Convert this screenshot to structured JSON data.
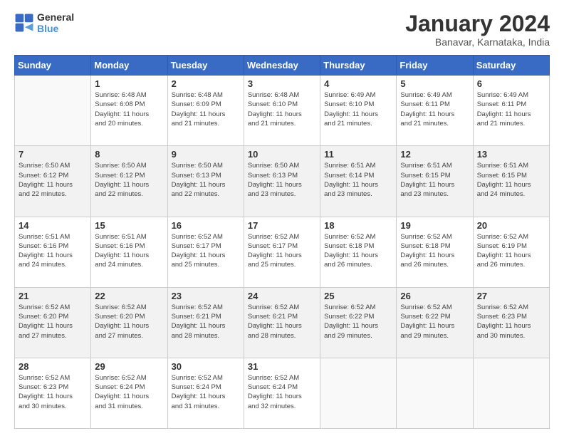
{
  "logo": {
    "line1": "General",
    "line2": "Blue"
  },
  "title": "January 2024",
  "subtitle": "Banavar, Karnataka, India",
  "days_of_week": [
    "Sunday",
    "Monday",
    "Tuesday",
    "Wednesday",
    "Thursday",
    "Friday",
    "Saturday"
  ],
  "weeks": [
    [
      {
        "day": "",
        "info": ""
      },
      {
        "day": "1",
        "info": "Sunrise: 6:48 AM\nSunset: 6:08 PM\nDaylight: 11 hours\nand 20 minutes."
      },
      {
        "day": "2",
        "info": "Sunrise: 6:48 AM\nSunset: 6:09 PM\nDaylight: 11 hours\nand 21 minutes."
      },
      {
        "day": "3",
        "info": "Sunrise: 6:48 AM\nSunset: 6:10 PM\nDaylight: 11 hours\nand 21 minutes."
      },
      {
        "day": "4",
        "info": "Sunrise: 6:49 AM\nSunset: 6:10 PM\nDaylight: 11 hours\nand 21 minutes."
      },
      {
        "day": "5",
        "info": "Sunrise: 6:49 AM\nSunset: 6:11 PM\nDaylight: 11 hours\nand 21 minutes."
      },
      {
        "day": "6",
        "info": "Sunrise: 6:49 AM\nSunset: 6:11 PM\nDaylight: 11 hours\nand 21 minutes."
      }
    ],
    [
      {
        "day": "7",
        "info": "Sunrise: 6:50 AM\nSunset: 6:12 PM\nDaylight: 11 hours\nand 22 minutes."
      },
      {
        "day": "8",
        "info": "Sunrise: 6:50 AM\nSunset: 6:12 PM\nDaylight: 11 hours\nand 22 minutes."
      },
      {
        "day": "9",
        "info": "Sunrise: 6:50 AM\nSunset: 6:13 PM\nDaylight: 11 hours\nand 22 minutes."
      },
      {
        "day": "10",
        "info": "Sunrise: 6:50 AM\nSunset: 6:13 PM\nDaylight: 11 hours\nand 23 minutes."
      },
      {
        "day": "11",
        "info": "Sunrise: 6:51 AM\nSunset: 6:14 PM\nDaylight: 11 hours\nand 23 minutes."
      },
      {
        "day": "12",
        "info": "Sunrise: 6:51 AM\nSunset: 6:15 PM\nDaylight: 11 hours\nand 23 minutes."
      },
      {
        "day": "13",
        "info": "Sunrise: 6:51 AM\nSunset: 6:15 PM\nDaylight: 11 hours\nand 24 minutes."
      }
    ],
    [
      {
        "day": "14",
        "info": "Sunrise: 6:51 AM\nSunset: 6:16 PM\nDaylight: 11 hours\nand 24 minutes."
      },
      {
        "day": "15",
        "info": "Sunrise: 6:51 AM\nSunset: 6:16 PM\nDaylight: 11 hours\nand 24 minutes."
      },
      {
        "day": "16",
        "info": "Sunrise: 6:52 AM\nSunset: 6:17 PM\nDaylight: 11 hours\nand 25 minutes."
      },
      {
        "day": "17",
        "info": "Sunrise: 6:52 AM\nSunset: 6:17 PM\nDaylight: 11 hours\nand 25 minutes."
      },
      {
        "day": "18",
        "info": "Sunrise: 6:52 AM\nSunset: 6:18 PM\nDaylight: 11 hours\nand 26 minutes."
      },
      {
        "day": "19",
        "info": "Sunrise: 6:52 AM\nSunset: 6:18 PM\nDaylight: 11 hours\nand 26 minutes."
      },
      {
        "day": "20",
        "info": "Sunrise: 6:52 AM\nSunset: 6:19 PM\nDaylight: 11 hours\nand 26 minutes."
      }
    ],
    [
      {
        "day": "21",
        "info": "Sunrise: 6:52 AM\nSunset: 6:20 PM\nDaylight: 11 hours\nand 27 minutes."
      },
      {
        "day": "22",
        "info": "Sunrise: 6:52 AM\nSunset: 6:20 PM\nDaylight: 11 hours\nand 27 minutes."
      },
      {
        "day": "23",
        "info": "Sunrise: 6:52 AM\nSunset: 6:21 PM\nDaylight: 11 hours\nand 28 minutes."
      },
      {
        "day": "24",
        "info": "Sunrise: 6:52 AM\nSunset: 6:21 PM\nDaylight: 11 hours\nand 28 minutes."
      },
      {
        "day": "25",
        "info": "Sunrise: 6:52 AM\nSunset: 6:22 PM\nDaylight: 11 hours\nand 29 minutes."
      },
      {
        "day": "26",
        "info": "Sunrise: 6:52 AM\nSunset: 6:22 PM\nDaylight: 11 hours\nand 29 minutes."
      },
      {
        "day": "27",
        "info": "Sunrise: 6:52 AM\nSunset: 6:23 PM\nDaylight: 11 hours\nand 30 minutes."
      }
    ],
    [
      {
        "day": "28",
        "info": "Sunrise: 6:52 AM\nSunset: 6:23 PM\nDaylight: 11 hours\nand 30 minutes."
      },
      {
        "day": "29",
        "info": "Sunrise: 6:52 AM\nSunset: 6:24 PM\nDaylight: 11 hours\nand 31 minutes."
      },
      {
        "day": "30",
        "info": "Sunrise: 6:52 AM\nSunset: 6:24 PM\nDaylight: 11 hours\nand 31 minutes."
      },
      {
        "day": "31",
        "info": "Sunrise: 6:52 AM\nSunset: 6:24 PM\nDaylight: 11 hours\nand 32 minutes."
      },
      {
        "day": "",
        "info": ""
      },
      {
        "day": "",
        "info": ""
      },
      {
        "day": "",
        "info": ""
      }
    ]
  ]
}
